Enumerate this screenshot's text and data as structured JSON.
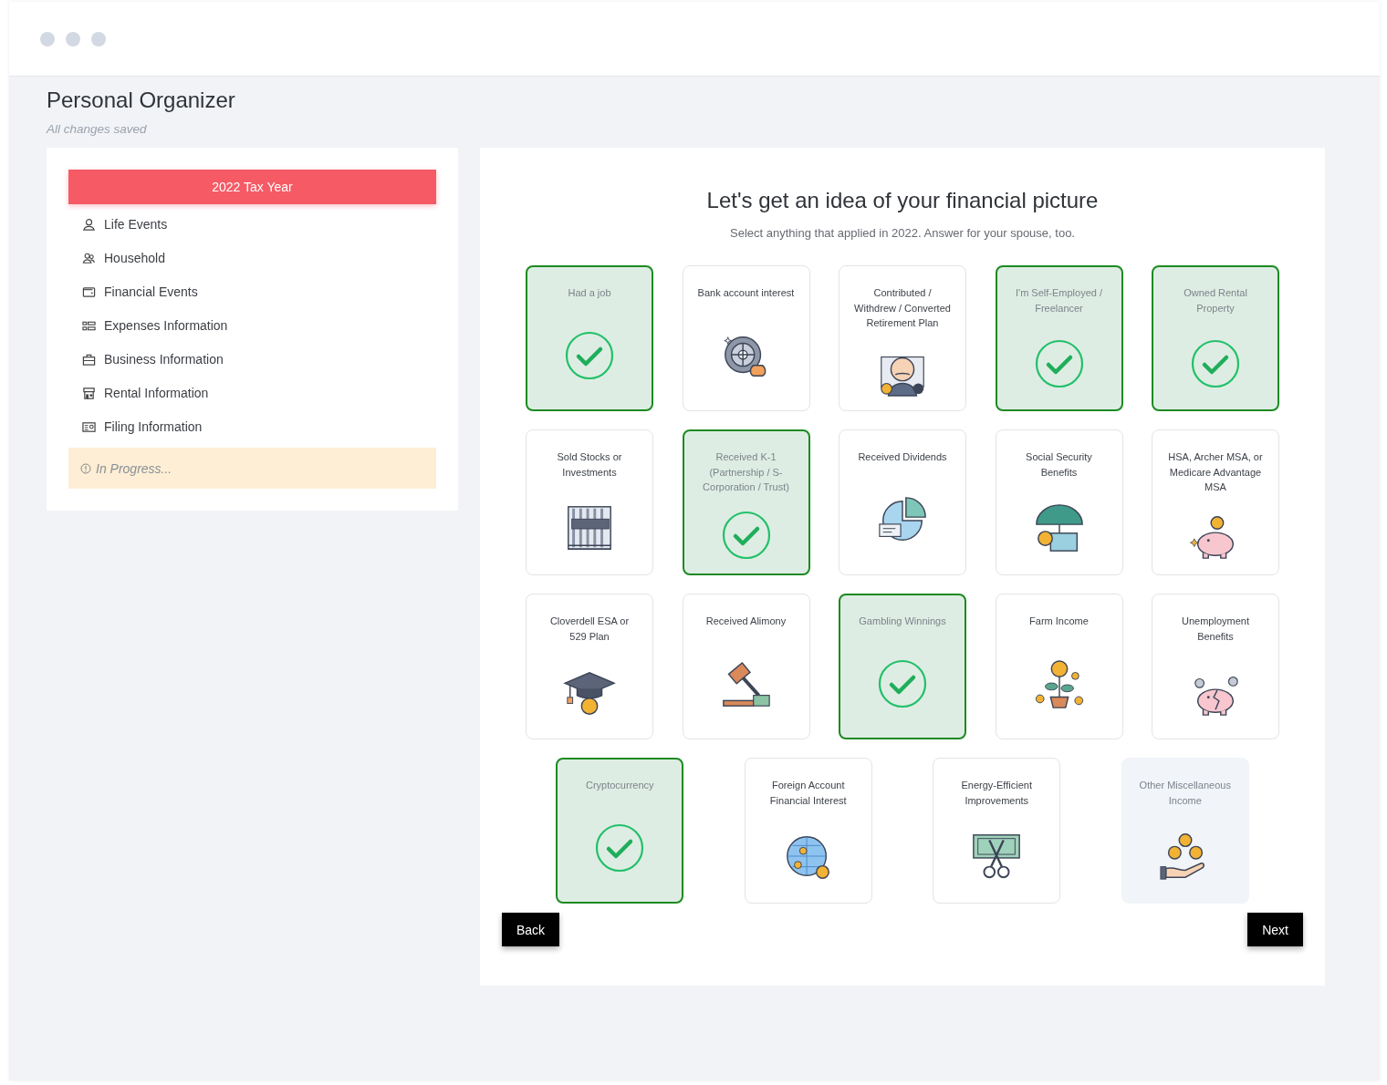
{
  "page": {
    "title": "Personal Organizer",
    "save_status": "All changes saved"
  },
  "sidebar": {
    "tax_year_button": "2022 Tax Year",
    "items": [
      {
        "label": "Life Events"
      },
      {
        "label": "Household"
      },
      {
        "label": "Financial Events"
      },
      {
        "label": "Expenses Information"
      },
      {
        "label": "Business Information"
      },
      {
        "label": "Rental Information"
      },
      {
        "label": "Filing Information"
      }
    ],
    "status": "In Progress..."
  },
  "main": {
    "heading": "Let's get an idea of your financial picture",
    "subheading": "Select anything that applied in 2022. Answer for your spouse, too.",
    "options": [
      {
        "label": "Had a job",
        "selected": true,
        "hovered": false
      },
      {
        "label": "Bank account interest",
        "selected": false,
        "hovered": false,
        "kind": "vault"
      },
      {
        "label": "Contributed / Withdrew / Converted Retirement Plan",
        "selected": false,
        "hovered": false,
        "kind": "retiree"
      },
      {
        "label": "I'm Self-Employed / Freelancer",
        "selected": true,
        "hovered": false
      },
      {
        "label": "Owned Rental Property",
        "selected": true,
        "hovered": false
      },
      {
        "label": "Sold Stocks or Investments",
        "selected": false,
        "hovered": false,
        "kind": "wallstreet"
      },
      {
        "label": "Received K-1 (Partnership / S-Corporation / Trust)",
        "selected": true,
        "hovered": false
      },
      {
        "label": "Received Dividends",
        "selected": false,
        "hovered": false,
        "kind": "piechart"
      },
      {
        "label": "Social Security Benefits",
        "selected": false,
        "hovered": false,
        "kind": "umbrella"
      },
      {
        "label": "HSA, Archer MSA, or Medicare Advantage MSA",
        "selected": false,
        "hovered": false,
        "kind": "piggybank"
      },
      {
        "label": "Cloverdell ESA or 529 Plan",
        "selected": false,
        "hovered": false,
        "kind": "gradcap"
      },
      {
        "label": "Received Alimony",
        "selected": false,
        "hovered": false,
        "kind": "gavel"
      },
      {
        "label": "Gambling Winnings",
        "selected": true,
        "hovered": false
      },
      {
        "label": "Farm Income",
        "selected": false,
        "hovered": false,
        "kind": "plant"
      },
      {
        "label": "Unemployment Benefits",
        "selected": false,
        "hovered": false,
        "kind": "brokenpiggy"
      },
      {
        "label": "Cryptocurrency",
        "selected": true,
        "hovered": false
      },
      {
        "label": "Foreign Account Financial Interest",
        "selected": false,
        "hovered": false,
        "kind": "globe"
      },
      {
        "label": "Energy-Efficient Improvements",
        "selected": false,
        "hovered": false,
        "kind": "banknote"
      },
      {
        "label": "Other Miscellaneous Income",
        "selected": false,
        "hovered": true,
        "kind": "coins"
      }
    ],
    "back_button": "Back",
    "next_button": "Next"
  }
}
